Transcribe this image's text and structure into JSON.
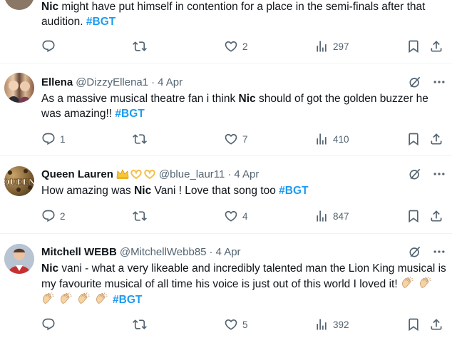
{
  "tweets": [
    {
      "text_parts": [
        "Nic",
        " might have put himself in contention for a place in the semi-finals after that audition. ",
        "#BGT"
      ],
      "stats": {
        "replies": "",
        "retweets": "",
        "likes": "2",
        "views": "297"
      }
    },
    {
      "name": "Ellena",
      "handle": "@DizzyEllena1",
      "dot": "·",
      "time": "4 Apr",
      "text_parts": [
        "As a massive musical theatre fan i think ",
        "Nic",
        " should of got the golden buzzer he was amazing!! ",
        "#BGT"
      ],
      "stats": {
        "replies": "1",
        "retweets": "",
        "likes": "7",
        "views": "410"
      }
    },
    {
      "name": "Queen Lauren",
      "handle": "@blue_laur11",
      "dot": "·",
      "time": "4 Apr",
      "avatar_text": "QUEEN",
      "text_parts": [
        "How amazing was ",
        "Nic",
        " Vani ! Love that song too ",
        "#BGT"
      ],
      "stats": {
        "replies": "2",
        "retweets": "",
        "likes": "4",
        "views": "847"
      }
    },
    {
      "name": "Mitchell WEBB",
      "handle": "@MitchellWebb85",
      "dot": "·",
      "time": "4 Apr",
      "text_parts": [
        "Nic",
        " vani - what a very likeable and incredibly talented man the Lion King musical is my favourite musical of all time his voice is just out of this world I loved it! ",
        "#BGT"
      ],
      "stats": {
        "replies": "",
        "retweets": "",
        "likes": "5",
        "views": "392"
      }
    }
  ],
  "colors": {
    "text": "#0f1419",
    "secondary": "#536471",
    "hashtag": "#1d9bf0",
    "divider": "#eff3f4"
  },
  "icons": [
    "reply-icon",
    "retweet-icon",
    "like-icon",
    "views-icon",
    "bookmark-icon",
    "share-icon",
    "grok-icon",
    "more-icon",
    "crown-emoji",
    "heart-hands-emoji",
    "clapping-hands-emoji"
  ]
}
